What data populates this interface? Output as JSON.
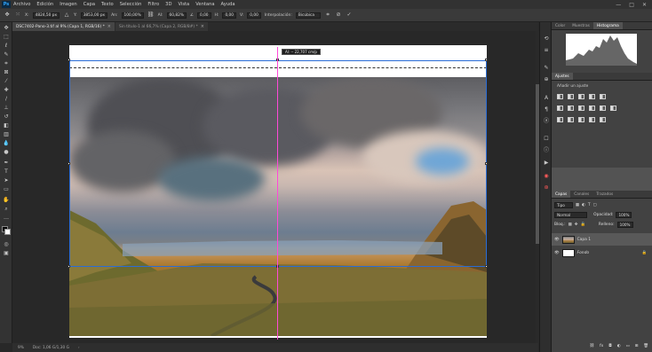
{
  "menubar": {
    "logo": "Ps",
    "items": [
      "Archivo",
      "Edición",
      "Imagen",
      "Capa",
      "Texto",
      "Selección",
      "Filtro",
      "3D",
      "Vista",
      "Ventana",
      "Ayuda"
    ],
    "window_buttons": [
      "—",
      "□",
      "✕"
    ]
  },
  "options": {
    "x_label": "X:",
    "x_value": "4824,50 px",
    "y_label": "Y:",
    "y_value": "3853,00 px",
    "w_label": "An:",
    "w_value": "100,00%",
    "h_label": "Al:",
    "h_value": "60,82%",
    "angle_label": "∠",
    "angle_value": "0,00",
    "h_skew_label": "H:",
    "h_skew_value": "0,00",
    "v_skew_label": "V:",
    "v_skew_value": "0,00",
    "interp_label": "Interpolación:",
    "interp_value": "Bicúbica",
    "cancel_icon": "⊘",
    "commit_icon": "✓"
  },
  "tabs": [
    {
      "label": "DSC7402-Pano-3.tif al 9% (Capa 1, RGB/16) *",
      "active": true
    },
    {
      "label": "Sin título-1 al 66,7% (Capa 2, RGB/8#) *",
      "active": false
    }
  ],
  "canvas": {
    "tooltip": "Al: -- 22,707 cm/p"
  },
  "status": {
    "zoom": "9%",
    "doc": "Doc: 1,06 G/1,30 G"
  },
  "panels": {
    "top_tabs": [
      "Color",
      "Muestras",
      "Histograma"
    ],
    "top_active": "Histograma",
    "adj_tab": "Ajustes",
    "adj_add": "Añadir un ajuste",
    "layers_tabs": [
      "Capas",
      "Canales",
      "Trazados"
    ],
    "layers_active": "Capas",
    "kind_filter": "Tipo",
    "blend_mode": "Normal",
    "opacity_label": "Opacidad:",
    "opacity_value": "100%",
    "lock_label": "Bloq.:",
    "fill_label": "Relleno:",
    "fill_value": "100%",
    "layers": [
      {
        "name": "Capa 1",
        "selected": true
      },
      {
        "name": "Fondo",
        "selected": false,
        "locked": true
      }
    ]
  },
  "colors": {
    "accent": "#31a8ff",
    "guide": "#ff49d8",
    "selection": "#2a6cd6"
  }
}
